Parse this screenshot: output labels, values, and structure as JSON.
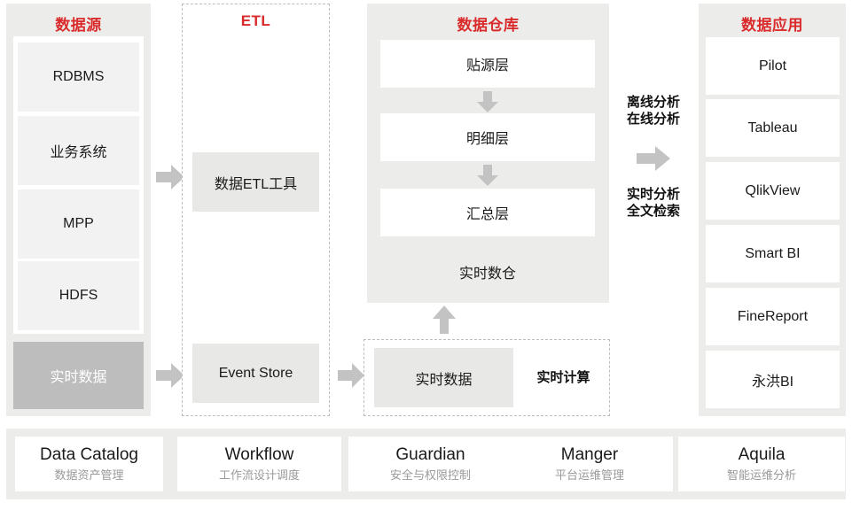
{
  "colors": {
    "title_red": "#d92b2b",
    "panel_bg": "#ececea",
    "box_light": "#f2f2f2",
    "box_gray": "#bdbdbd",
    "arrow_gray": "#c3c3c3",
    "page_bg": "#ffffff",
    "subtitle_gray": "#9a9a9a"
  },
  "columns": {
    "data_source": {
      "title": "数据源",
      "items": [
        {
          "label": "RDBMS"
        },
        {
          "label": "业务系统"
        },
        {
          "label": "MPP"
        },
        {
          "label": "HDFS"
        }
      ],
      "realtime": {
        "label": "实时数据"
      }
    },
    "etl": {
      "title": "ETL",
      "items": [
        {
          "label": "数据ETL工具"
        },
        {
          "label": "Event Store"
        }
      ]
    },
    "warehouse": {
      "title": "数据仓库",
      "layers": [
        {
          "label": "贴源层"
        },
        {
          "label": "明细层"
        },
        {
          "label": "汇总层"
        }
      ],
      "realtime_warehouse": "实时数仓"
    },
    "realtime_compute": {
      "data_label": "实时数据",
      "title": "实时计算"
    },
    "analysis_labels": {
      "top": "离线分析\n在线分析",
      "bottom": "实时分析\n全文检索"
    },
    "data_app": {
      "title": "数据应用",
      "items": [
        {
          "label": "Pilot"
        },
        {
          "label": "Tableau"
        },
        {
          "label": "QlikView"
        },
        {
          "label": "Smart BI"
        },
        {
          "label": "FineReport"
        },
        {
          "label": "永洪BI"
        }
      ]
    }
  },
  "footer": {
    "cards": [
      {
        "title": "Data Catalog",
        "subtitle": "数据资产管理"
      },
      {
        "title": "Workflow",
        "subtitle": "工作流设计调度"
      },
      {
        "title": "Guardian",
        "subtitle": "安全与权限控制"
      },
      {
        "title": "Manger",
        "subtitle": "平台运维管理"
      },
      {
        "title": "Aquila",
        "subtitle": "智能运维分析"
      }
    ]
  },
  "arrows": {
    "source_to_etl": "arrow-right-icon",
    "source_realtime_to_eventstore": "arrow-right-icon",
    "eventstore_to_compute": "arrow-right-icon",
    "layer_flow": "arrow-down-icon",
    "compute_to_warehouse": "arrow-up-icon",
    "warehouse_to_app": "arrow-right-icon"
  }
}
